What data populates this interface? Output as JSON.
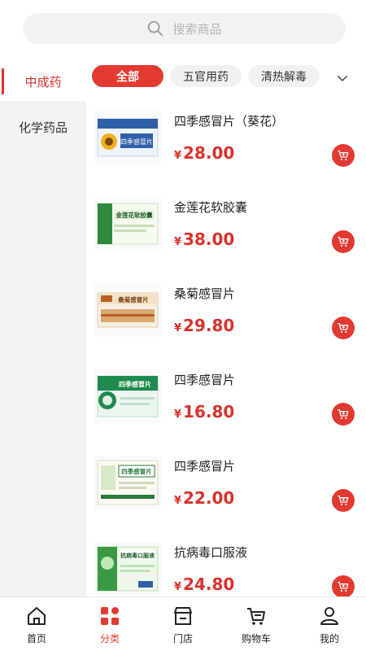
{
  "search": {
    "placeholder": "搜索商品"
  },
  "left_nav": {
    "active": "中成药",
    "items": [
      "化学药品"
    ]
  },
  "tabs": [
    {
      "label": "全部",
      "active": true
    },
    {
      "label": "五官用药",
      "active": false
    },
    {
      "label": "清热解毒",
      "active": false
    }
  ],
  "currency": "¥",
  "products": [
    {
      "name": "四季感冒片（葵花）",
      "price": "28.00",
      "box_text": "四季感冒片",
      "box_color": "#2f5fa8"
    },
    {
      "name": "金莲花软胶囊",
      "price": "38.00",
      "box_text": "金莲花软胶囊",
      "box_color": "#2e8a3a"
    },
    {
      "name": "桑菊感冒片",
      "price": "29.80",
      "box_text": "桑菊感冒片",
      "box_color": "#b7612a"
    },
    {
      "name": "四季感冒片",
      "price": "16.80",
      "box_text": "四季感冒片",
      "box_color": "#1f8a4f"
    },
    {
      "name": "四季感冒片",
      "price": "22.00",
      "box_text": "四季感冒片",
      "box_color": "#2a7a3d"
    },
    {
      "name": "抗病毒口服液",
      "price": "24.80",
      "box_text": "抗病毒口服液",
      "box_color": "#3a9a44"
    }
  ],
  "bottom_nav": [
    {
      "label": "首页",
      "icon": "home-icon",
      "active": false
    },
    {
      "label": "分类",
      "icon": "category-icon",
      "active": true
    },
    {
      "label": "门店",
      "icon": "store-icon",
      "active": false
    },
    {
      "label": "购物车",
      "icon": "cart-icon",
      "active": false
    },
    {
      "label": "我的",
      "icon": "user-icon",
      "active": false
    }
  ],
  "colors": {
    "accent": "#e23a30",
    "price": "#d8322c"
  }
}
